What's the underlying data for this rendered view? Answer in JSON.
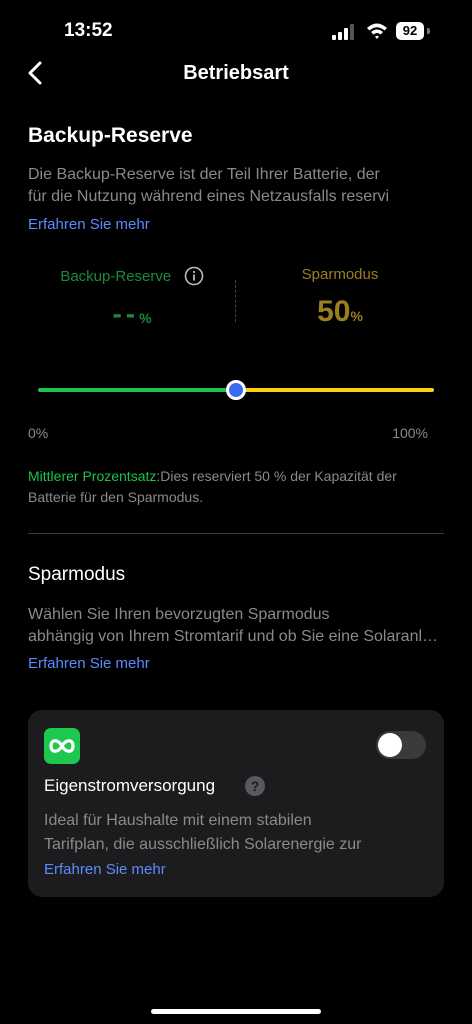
{
  "status": {
    "time": "13:52",
    "battery": "92"
  },
  "nav": {
    "title": "Betriebsart"
  },
  "backup": {
    "title": "Backup-Reserve",
    "desc_line1": "Die Backup-Reserve ist der Teil Ihrer Batterie, der",
    "desc_line2": "für die Nutzung während eines Netzausfalls reservi",
    "learn_more": "Erfahren Sie mehr",
    "reserve_label": "Backup-Reserve",
    "reserve_value": "--",
    "reserve_unit": "%",
    "saving_label": "Sparmodus",
    "saving_value": "50",
    "saving_unit": "%",
    "slider_value_percent": 50,
    "range_min": "0%",
    "range_max": "100%",
    "note_highlight": "Mittlerer Prozentsatz",
    "note_text": ":Dies reserviert 50 % der Kapazität der Batterie für den Sparmodus.",
    "colors": {
      "reserve": "#1cc34a",
      "saving": "#f6d21a",
      "thumb": "#3a6cf0"
    }
  },
  "mode": {
    "title": "Sparmodus",
    "desc_line1": "Wählen Sie Ihren bevorzugten Sparmodus",
    "desc_line2": "abhängig von Ihrem Stromtarif und ob Sie eine Solaranlage",
    "learn_more": "Erfahren Sie mehr"
  },
  "card": {
    "icon": "infinity-icon",
    "toggle_on": false,
    "title": "Eigenstromversorgung",
    "desc_line1": "Ideal für Haushalte mit einem stabilen",
    "desc_line2": "Tarifplan, die ausschließlich Solarenergie zur",
    "learn_more": "Erfahren Sie mehr"
  }
}
